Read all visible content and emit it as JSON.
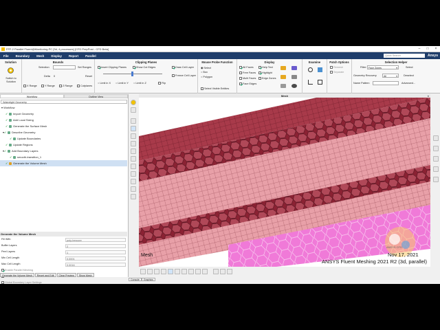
{
  "window": {
    "title": "FFF-2 Parallel Fluent@Monitoring-PC [3d, 4 processes] [CFD PrepPost - CFD Beta]"
  },
  "menu": {
    "items": [
      "File",
      "Boundary",
      "Mesh",
      "Display",
      "Report",
      "Parallel"
    ],
    "quick_search": "Quick Search",
    "brand": "Ansys"
  },
  "ribbon": {
    "solution": {
      "title": "Solution",
      "switch_label": "Switch to Solution"
    },
    "bounds": {
      "title": "Bounds",
      "selection_label": "Selection",
      "set_ranges": "Set Ranges",
      "delta_label": "Delta",
      "delta_value": "0",
      "reset": "Reset",
      "x_range": "X Range",
      "y_range": "Y Range",
      "z_range": "Z Range",
      "cutplanes": "Cutplanes"
    },
    "clipping": {
      "title": "Clipping Planes",
      "insert": "Insert Clipping Planes",
      "show_cut_edges": "Show Cut Edges",
      "draw_cell_layer": "Draw Cell Layer",
      "freeze_cell_layer": "Freeze Cell Layer",
      "limit_x": "Limit in X",
      "limit_y": "Limit in Y",
      "limit_z": "Limit in Z",
      "flip": "Flip"
    },
    "probe": {
      "title": "Mouse Probe Function",
      "select": "Select",
      "box": "Box",
      "polygon": "Polygon",
      "select_visible": "Select Visible Entities"
    },
    "display": {
      "title": "Display",
      "all_faces": "All Faces",
      "free_faces": "Free Faces",
      "multi_faces": "Multi Faces",
      "face_edges": "Face Edges",
      "help_text": "Help Text",
      "highlight": "Highlight",
      "edge_zones": "Edge Zones"
    },
    "examine": {
      "title": "Examine"
    },
    "patch": {
      "title": "Patch Options",
      "remesh": "Remesh",
      "separate": "Separate"
    },
    "selection_helper": {
      "title": "Selection Helper",
      "filter_label": "Filter:",
      "filter_value": "Face Zones",
      "recovery_label": "Geometry Recovery",
      "recovery_value": "All",
      "name_pattern_label": "Name Pattern",
      "select": "Select",
      "deselect": "Deselect",
      "advanced": "Advanced..."
    }
  },
  "left_panel": {
    "tabs": [
      "Workflow",
      "Outline View"
    ],
    "workflow_type": "Watertight Geometry",
    "tree_root": "Workflow",
    "tree": [
      {
        "label": "Import Geometry"
      },
      {
        "label": "Add Local Sizing"
      },
      {
        "label": "Generate the Surface Mesh"
      },
      {
        "label": "Describe Geometry"
      },
      {
        "label": "Update Boundaries"
      },
      {
        "label": "Update Regions"
      },
      {
        "label": "Add Boundary Layers"
      },
      {
        "label": "smooth-transition_1"
      },
      {
        "label": "Generate the Volume Mesh"
      }
    ],
    "task_title": "Generate the Volume Mesh",
    "props": [
      {
        "label": "Fill With",
        "value": "poly-hexcore"
      },
      {
        "label": "Buffer Layers",
        "value": "2"
      },
      {
        "label": "Peel Layers",
        "value": "1"
      },
      {
        "label": "Min Cell Length",
        "value": "0.0001"
      },
      {
        "label": "Max Cell Length",
        "value": "0.0016"
      }
    ],
    "options": [
      "Enable Parallel Meshing",
      "Advanced Options",
      "Global Boundary Layer Settings"
    ],
    "buttons": [
      "Generate the Volume Mesh",
      "Revert and Edit",
      "Clear Preview",
      "Show Mesh"
    ]
  },
  "graphics": {
    "title": "Mesh",
    "label": "Mesh",
    "date": "Nov 17, 2021",
    "version": "ANSYS Fluent Meshing 2021 R2 (3d, parallel)",
    "watermark": "ANSYS CFD",
    "colors": {
      "dark": "#7a1a2a",
      "mid": "#a83a4a",
      "light": "#e8a0a8",
      "pink": "#f07ad8"
    }
  },
  "console_tabs": [
    "Console",
    "Graphics"
  ]
}
